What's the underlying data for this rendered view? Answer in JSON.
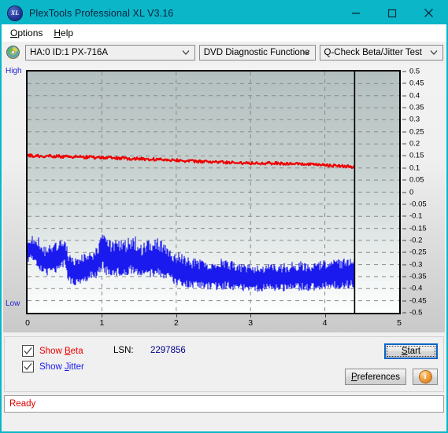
{
  "window": {
    "title": "PlexTools Professional XL V3.16",
    "icon": "xl-logo-icon",
    "minimize": "minimize-icon",
    "maximize": "maximize-icon",
    "close": "close-icon"
  },
  "menubar": {
    "items": [
      {
        "label": "Options",
        "accel": "O"
      },
      {
        "label": "Help",
        "accel": "H"
      }
    ]
  },
  "toolbar": {
    "disc_icon": "disc-icon",
    "drive_select": "HA:0 ID:1  PX-716A",
    "function_select": "DVD Diagnostic Functions",
    "test_select": "Q-Check Beta/Jitter Test",
    "caret_icon": "chevron-down-icon"
  },
  "chart_labels": {
    "axis_left_high": "High",
    "axis_left_low": "Low"
  },
  "controls": {
    "show_beta": "Show Beta",
    "show_jitter": "Show Jitter",
    "beta_color": "#ee0000",
    "jitter_color": "#1a1aee",
    "lsn_label": "LSN:",
    "lsn_value": "2297856",
    "start_label": "Start",
    "preferences_label": "Preferences",
    "info_label": "i",
    "check_icon": "check-icon"
  },
  "statusbar": {
    "text": "Ready",
    "color": "#dd0000"
  },
  "chart_data": {
    "type": "line",
    "title": "Q-Check Beta/Jitter Test",
    "xlabel": "",
    "ylabel": "",
    "xlim": [
      0,
      5
    ],
    "ylim": [
      -0.5,
      0.5
    ],
    "grid": true,
    "legend": "none",
    "x_ticks": [
      0,
      1,
      2,
      3,
      4,
      5
    ],
    "y_ticks": [
      0.5,
      0.45,
      0.4,
      0.35,
      0.3,
      0.25,
      0.2,
      0.15,
      0.1,
      0.05,
      0,
      -0.05,
      -0.1,
      -0.15,
      -0.2,
      -0.25,
      -0.3,
      -0.35,
      -0.4,
      -0.45,
      -0.5
    ],
    "y_tick_labels": [
      "0.5",
      "0.45",
      "0.4",
      "0.35",
      "0.3",
      "0.25",
      "0.2",
      "0.15",
      "0.1",
      "0.05",
      "0",
      "-0.05",
      "-0.1",
      "-0.15",
      "-0.2",
      "-0.25",
      "-0.3",
      "-0.35",
      "-0.4",
      "-0.45",
      "-0.5"
    ],
    "data_end_x": 4.4,
    "marker_line_x": 4.4,
    "left_axis_labels": {
      "top": "High",
      "bottom": "Low"
    },
    "series": [
      {
        "name": "Beta",
        "color": "#ee0000",
        "type": "line",
        "x": [
          0.0,
          0.1,
          0.2,
          0.3,
          0.4,
          0.5,
          0.6,
          0.7,
          0.8,
          0.9,
          1.0,
          1.1,
          1.2,
          1.3,
          1.4,
          1.5,
          1.6,
          1.7,
          1.8,
          1.9,
          2.0,
          2.1,
          2.2,
          2.3,
          2.4,
          2.5,
          2.6,
          2.7,
          2.8,
          2.9,
          3.0,
          3.1,
          3.2,
          3.3,
          3.4,
          3.5,
          3.6,
          3.7,
          3.8,
          3.9,
          4.0,
          4.1,
          4.2,
          4.3,
          4.4
        ],
        "values": [
          0.152,
          0.15,
          0.149,
          0.15,
          0.148,
          0.148,
          0.147,
          0.146,
          0.145,
          0.144,
          0.143,
          0.142,
          0.141,
          0.14,
          0.139,
          0.138,
          0.137,
          0.136,
          0.135,
          0.134,
          0.133,
          0.13,
          0.128,
          0.127,
          0.126,
          0.125,
          0.124,
          0.123,
          0.122,
          0.122,
          0.121,
          0.121,
          0.12,
          0.12,
          0.119,
          0.118,
          0.117,
          0.116,
          0.114,
          0.113,
          0.112,
          0.11,
          0.108,
          0.106,
          0.104
        ]
      },
      {
        "name": "Jitter",
        "color": "#1a1aee",
        "type": "band",
        "x": [
          0.0,
          0.05,
          0.1,
          0.15,
          0.2,
          0.25,
          0.3,
          0.35,
          0.4,
          0.45,
          0.5,
          0.55,
          0.6,
          0.65,
          0.7,
          0.75,
          0.8,
          0.85,
          0.9,
          0.95,
          1.0,
          1.05,
          1.1,
          1.15,
          1.2,
          1.25,
          1.3,
          1.35,
          1.4,
          1.45,
          1.5,
          1.55,
          1.6,
          1.65,
          1.7,
          1.75,
          1.8,
          1.85,
          1.9,
          1.95,
          2.0,
          2.1,
          2.2,
          2.3,
          2.4,
          2.5,
          2.6,
          2.7,
          2.8,
          2.9,
          3.0,
          3.1,
          3.2,
          3.3,
          3.4,
          3.5,
          3.6,
          3.7,
          3.8,
          3.9,
          4.0,
          4.1,
          4.2,
          4.3,
          4.4
        ],
        "upper": [
          -0.215,
          -0.2,
          -0.205,
          -0.215,
          -0.25,
          -0.255,
          -0.24,
          -0.23,
          -0.23,
          -0.218,
          -0.205,
          -0.28,
          -0.295,
          -0.3,
          -0.29,
          -0.28,
          -0.275,
          -0.262,
          -0.268,
          -0.25,
          -0.195,
          -0.225,
          -0.23,
          -0.235,
          -0.23,
          -0.228,
          -0.232,
          -0.225,
          -0.222,
          -0.22,
          -0.24,
          -0.248,
          -0.235,
          -0.238,
          -0.222,
          -0.218,
          -0.23,
          -0.245,
          -0.258,
          -0.268,
          -0.278,
          -0.29,
          -0.3,
          -0.305,
          -0.31,
          -0.315,
          -0.3,
          -0.305,
          -0.318,
          -0.322,
          -0.325,
          -0.325,
          -0.322,
          -0.32,
          -0.322,
          -0.318,
          -0.315,
          -0.312,
          -0.315,
          -0.312,
          -0.308,
          -0.305,
          -0.302,
          -0.3,
          -0.3
        ],
        "lower": [
          -0.275,
          -0.265,
          -0.27,
          -0.3,
          -0.32,
          -0.33,
          -0.322,
          -0.312,
          -0.318,
          -0.3,
          -0.285,
          -0.36,
          -0.368,
          -0.37,
          -0.362,
          -0.355,
          -0.35,
          -0.34,
          -0.345,
          -0.33,
          -0.3,
          -0.318,
          -0.322,
          -0.33,
          -0.325,
          -0.322,
          -0.33,
          -0.322,
          -0.318,
          -0.318,
          -0.335,
          -0.34,
          -0.33,
          -0.335,
          -0.325,
          -0.32,
          -0.33,
          -0.34,
          -0.35,
          -0.358,
          -0.365,
          -0.372,
          -0.378,
          -0.382,
          -0.385,
          -0.388,
          -0.382,
          -0.384,
          -0.39,
          -0.392,
          -0.395,
          -0.394,
          -0.392,
          -0.392,
          -0.394,
          -0.392,
          -0.39,
          -0.388,
          -0.39,
          -0.388,
          -0.386,
          -0.384,
          -0.382,
          -0.38,
          -0.378
        ]
      }
    ]
  }
}
